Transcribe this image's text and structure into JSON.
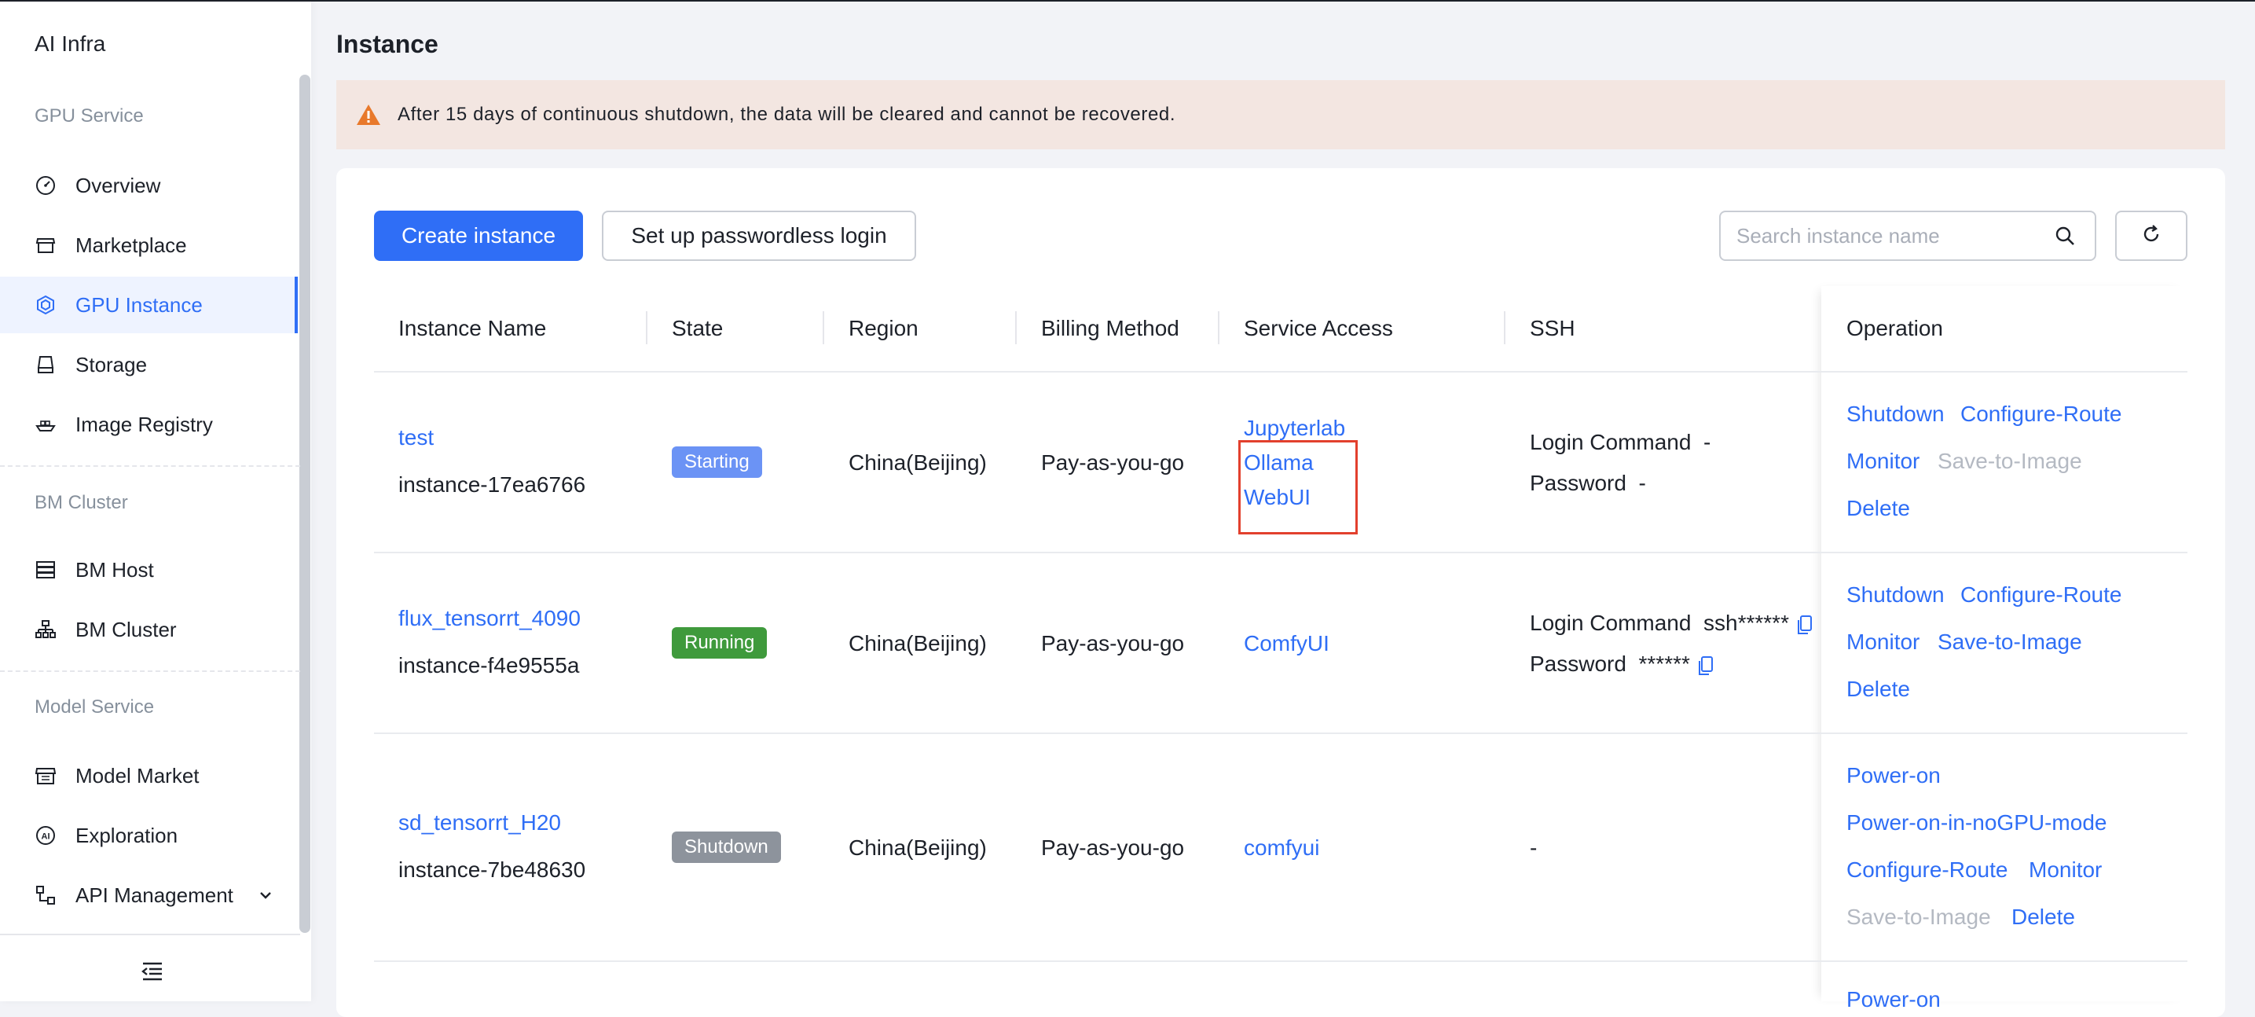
{
  "sidebar": {
    "brand": "AI Infra",
    "sections": [
      {
        "title": "GPU Service"
      },
      {
        "title": "BM Cluster"
      },
      {
        "title": "Model Service"
      }
    ],
    "items": [
      {
        "label": "Overview",
        "icon": "gauge-icon"
      },
      {
        "label": "Marketplace",
        "icon": "store-icon"
      },
      {
        "label": "GPU Instance",
        "icon": "gpu-chip-icon",
        "active": true
      },
      {
        "label": "Storage",
        "icon": "storage-drive-icon"
      },
      {
        "label": "Image Registry",
        "icon": "container-ship-icon"
      },
      {
        "label": "BM Host",
        "icon": "server-rack-icon"
      },
      {
        "label": "BM Cluster",
        "icon": "cluster-tree-icon"
      },
      {
        "label": "Model Market",
        "icon": "market-grid-icon"
      },
      {
        "label": "Exploration",
        "icon": "ai-badge-icon"
      },
      {
        "label": "API Management",
        "icon": "api-nodes-icon"
      }
    ]
  },
  "page": {
    "title": "Instance",
    "alert": "After 15 days of continuous shutdown, the data will be cleared and cannot be recovered."
  },
  "toolbar": {
    "create_label": "Create instance",
    "passwordless_label": "Set up passwordless login",
    "search_placeholder": "Search instance name"
  },
  "table": {
    "columns": [
      "Instance Name",
      "State",
      "Region",
      "Billing Method",
      "Service Access",
      "SSH",
      "Operation"
    ],
    "rows": [
      {
        "name": "test",
        "id": "instance-17ea6766",
        "state": "Starting",
        "region": "China(Beijing)",
        "billing": "Pay-as-you-go",
        "services": [
          "Jupyterlab",
          "Ollama",
          "WebUI"
        ],
        "ssh_login_label": "Login Command",
        "ssh_login_value": "-",
        "ssh_password_label": "Password",
        "ssh_password_value": "-",
        "ops": {
          "shutdown": "Shutdown",
          "configure_route": "Configure-Route",
          "monitor": "Monitor",
          "save_to_image": "Save-to-Image",
          "delete": "Delete"
        }
      },
      {
        "name": "flux_tensorrt_4090",
        "id": "instance-f4e9555a",
        "state": "Running",
        "region": "China(Beijing)",
        "billing": "Pay-as-you-go",
        "services": [
          "ComfyUI"
        ],
        "ssh_login_label": "Login Command",
        "ssh_login_value": "ssh******",
        "ssh_password_label": "Password",
        "ssh_password_value": "******",
        "ops": {
          "shutdown": "Shutdown",
          "configure_route": "Configure-Route",
          "monitor": "Monitor",
          "save_to_image": "Save-to-Image",
          "delete": "Delete"
        }
      },
      {
        "name": "sd_tensorrt_H20",
        "id": "instance-7be48630",
        "state": "Shutdown",
        "region": "China(Beijing)",
        "billing": "Pay-as-you-go",
        "services": [
          "comfyui"
        ],
        "ssh_value": "-",
        "ops": {
          "power_on": "Power-on",
          "power_on_nogpu": "Power-on-in-noGPU-mode",
          "configure_route": "Configure-Route",
          "monitor": "Monitor",
          "save_to_image": "Save-to-Image",
          "delete": "Delete"
        }
      }
    ],
    "partial_next_op": "Power-on"
  },
  "colors": {
    "primary": "#2f6ef6",
    "alert_bg": "#f3e6e1",
    "warning": "#e8792b",
    "highlight": "#e2402d"
  }
}
